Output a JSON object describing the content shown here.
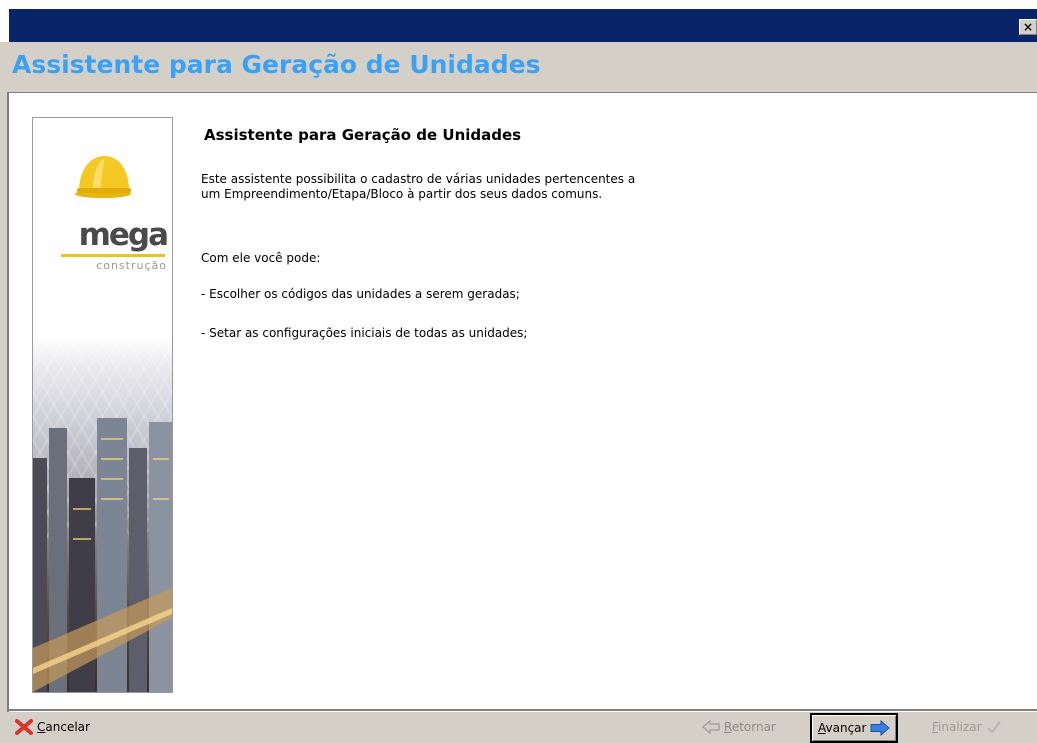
{
  "window": {
    "close_glyph": "×"
  },
  "header": {
    "title": "Assistente para Geração de Unidades"
  },
  "banner": {
    "logo_text": "mega",
    "logo_subtext": "construção",
    "colors": {
      "helmet": "#f2c21a",
      "logo_bar": "#f1c21b",
      "title": "#3ba1f5"
    }
  },
  "main": {
    "heading": "Assistente para Geração de Unidades",
    "intro_line1": "Este assistente possibilita o cadastro de várias unidades pertencentes a",
    "intro_line2": "um Empreendimento/Etapa/Bloco à partir dos seus dados comuns.",
    "can_do": "Com ele você pode:",
    "bullet1": "- Escolher os códigos das unidades a serem geradas;",
    "bullet2": "- Setar as configurações iniciais de todas as unidades;"
  },
  "footer": {
    "cancel": {
      "first": "C",
      "rest": "ancelar",
      "icon": "x-icon"
    },
    "back": {
      "first": "R",
      "rest": "etornar",
      "icon": "arrow-left-icon"
    },
    "next": {
      "first": "A",
      "rest": "vançar",
      "icon": "arrow-right-icon"
    },
    "finish": {
      "first": "F",
      "rest": "inalizar",
      "icon": "check-icon"
    }
  }
}
